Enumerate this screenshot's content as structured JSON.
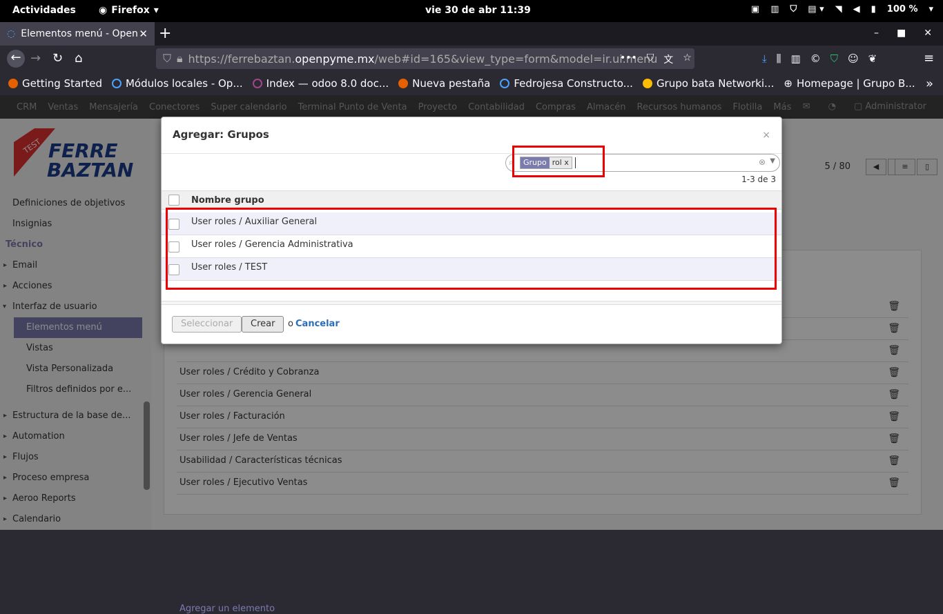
{
  "system": {
    "activities": "Actividades",
    "app": "Firefox",
    "clock": "vie 30 de abr  11:39",
    "battery": "100 %"
  },
  "browser": {
    "tab_title": "Elementos menú - Open",
    "url_gray": "https://ferrebaztan.",
    "url_main": "openpyme.mx",
    "url_rest": "/web#id=165&view_type=form&model=ir.ui.menu",
    "bookmarks": [
      "Getting Started",
      "Módulos locales - Op...",
      "Index — odoo 8.0 doc...",
      "Nueva pestaña",
      "Fedrojesa Constructo...",
      "Grupo bata Networki...",
      "Homepage | Grupo B..."
    ]
  },
  "odoo_nav": {
    "items": [
      "CRM",
      "Ventas",
      "Mensajería",
      "Conectores",
      "Super calendario",
      "Terminal Punto de Venta",
      "Proyecto",
      "Contabilidad",
      "Compras",
      "Almacén",
      "Recursos humanos",
      "Flotilla",
      "Más"
    ],
    "user": "Administrator"
  },
  "logo": {
    "line1": "FERRE",
    "line2": "BAZTAN",
    "ribbon": "TEST"
  },
  "sidebar": {
    "items": [
      {
        "label": "Definiciones de objetivos",
        "kind": "sub0"
      },
      {
        "label": "Insignias",
        "kind": "sub0"
      },
      {
        "label": "Técnico",
        "kind": "head"
      },
      {
        "label": "Email",
        "kind": "arrow"
      },
      {
        "label": "Acciones",
        "kind": "arrow"
      },
      {
        "label": "Interfaz de usuario",
        "kind": "open"
      },
      {
        "label": "Elementos menú",
        "kind": "active"
      },
      {
        "label": "Vistas",
        "kind": "sub"
      },
      {
        "label": "Vista Personalizada",
        "kind": "sub"
      },
      {
        "label": "Filtros definidos por e...",
        "kind": "sub"
      },
      {
        "label": "Estructura de la base de...",
        "kind": "arrow"
      },
      {
        "label": "Automation",
        "kind": "arrow"
      },
      {
        "label": "Flujos",
        "kind": "arrow"
      },
      {
        "label": "Proceso empresa",
        "kind": "arrow"
      },
      {
        "label": "Aeroo Reports",
        "kind": "arrow"
      },
      {
        "label": "Calendario",
        "kind": "arrow"
      }
    ]
  },
  "form": {
    "pager": "5 / 80",
    "group_rows": [
      "User roles / Crédito y Cobranza",
      "User roles / Gerencia General",
      "User roles / Facturación",
      "User roles / Jefe de Ventas",
      "Usabilidad / Características técnicas",
      "User roles / Ejecutivo Ventas"
    ],
    "add_item": "Agregar un elemento"
  },
  "modal": {
    "title": "Agregar: Grupos",
    "close": "×",
    "facet_label": "Grupo",
    "facet_value": "rol",
    "facet_remove": "x",
    "count": "1-3 de 3",
    "column_header": "Nombre grupo",
    "rows": [
      "User roles / Auxiliar General",
      "User roles / Gerencia Administrativa",
      "User roles / TEST"
    ],
    "select_btn": "Seleccionar",
    "create_btn": "Crear",
    "or": "o",
    "cancel": "Cancelar"
  },
  "colors": {
    "accent": "#7c7bad",
    "highlight": "#e00000"
  }
}
